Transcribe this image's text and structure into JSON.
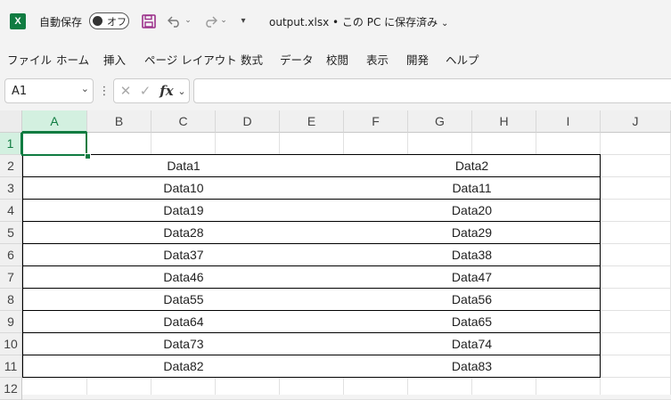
{
  "titlebar": {
    "autosave_label": "自動保存",
    "toggle_label": "オフ",
    "filename": "output.xlsx • この PC に保存済み"
  },
  "ribbon": {
    "tabs": [
      "ファイル",
      "ホーム",
      "挿入",
      "ページ レイアウト",
      "数式",
      "データ",
      "校閲",
      "表示",
      "開発",
      "ヘルプ"
    ]
  },
  "formula_bar": {
    "name_box": "A1",
    "fx": "fx",
    "value": ""
  },
  "sheet": {
    "columns": [
      "A",
      "B",
      "C",
      "D",
      "E",
      "F",
      "G",
      "H",
      "I",
      "J"
    ],
    "rows": [
      "1",
      "2",
      "3",
      "4",
      "5",
      "6",
      "7",
      "8",
      "9",
      "10",
      "11",
      "12"
    ],
    "selected_cell": "A1",
    "table": [
      [
        "Data1",
        "Data2"
      ],
      [
        "Data10",
        "Data11"
      ],
      [
        "Data19",
        "Data20"
      ],
      [
        "Data28",
        "Data29"
      ],
      [
        "Data37",
        "Data38"
      ],
      [
        "Data46",
        "Data47"
      ],
      [
        "Data55",
        "Data56"
      ],
      [
        "Data64",
        "Data65"
      ],
      [
        "Data73",
        "Data74"
      ],
      [
        "Data82",
        "Data83"
      ]
    ]
  },
  "colors": {
    "accent": "#107c41",
    "save_icon": "#9b2f8a"
  },
  "icons": [
    "excel-logo-icon",
    "save-icon",
    "undo-icon",
    "redo-icon",
    "quick-access-dropdown-icon",
    "chevron-down-icon",
    "cancel-icon",
    "enter-icon",
    "function-icon"
  ]
}
